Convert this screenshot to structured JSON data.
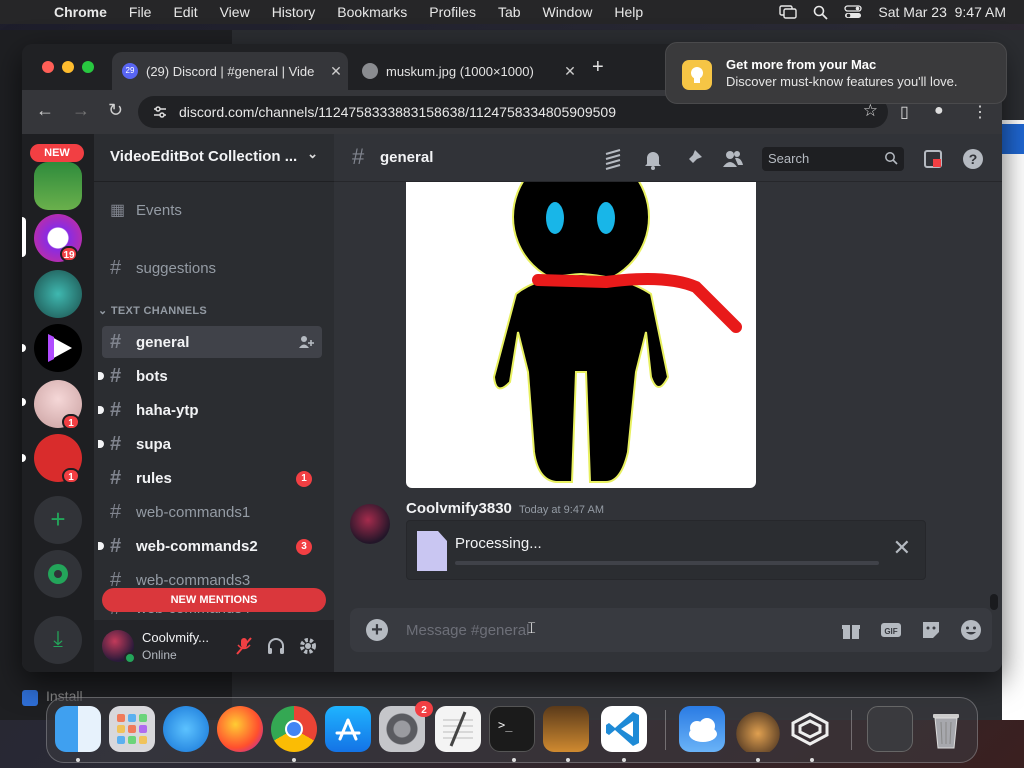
{
  "menubar": {
    "app": "Chrome",
    "items": [
      "File",
      "Edit",
      "View",
      "History",
      "Bookmarks",
      "Profiles",
      "Tab",
      "Window",
      "Help"
    ],
    "datetime": "Sat Mar 23  9:47 AM"
  },
  "browser": {
    "tabs": [
      {
        "title": "(29) Discord | #general | Vide",
        "badge": "29",
        "active": true
      },
      {
        "title": "muskum.jpg (1000×1000)",
        "active": false
      }
    ],
    "url": "discord.com/channels/1124758333883158638/1124758334805909509"
  },
  "notification": {
    "title": "Get more from your Mac",
    "body": "Discover must-know features you'll love."
  },
  "discord": {
    "guilds": [
      {
        "name": "new-server",
        "badge": null,
        "new_label": "NEW"
      },
      {
        "name": "video-server",
        "badge": "19"
      },
      {
        "name": "pool-server",
        "badge": null
      },
      {
        "name": "play-server",
        "badge": null
      },
      {
        "name": "anime-server",
        "badge": "1"
      },
      {
        "name": "red-server",
        "badge": "1"
      }
    ],
    "server": {
      "name": "VideoEditBot Collection ..."
    },
    "events_label": "Events",
    "suggestions_label": "suggestions",
    "category": "TEXT CHANNELS",
    "channels": [
      {
        "name": "general",
        "state": "active"
      },
      {
        "name": "bots",
        "state": "unread"
      },
      {
        "name": "haha-ytp",
        "state": "unread"
      },
      {
        "name": "supa",
        "state": "unread"
      },
      {
        "name": "rules",
        "state": "unread",
        "badge": "1"
      },
      {
        "name": "web-commands1",
        "state": "read"
      },
      {
        "name": "web-commands2",
        "state": "unread",
        "badge": "3"
      },
      {
        "name": "web-commands3",
        "state": "read"
      },
      {
        "name": "web-commands4",
        "state": "read"
      }
    ],
    "new_mentions": "NEW MENTIONS",
    "user": {
      "name": "Coolvmify...",
      "status": "Online"
    },
    "channel_header": "general",
    "search_placeholder": "Search",
    "message": {
      "author": "Coolvmify3830",
      "timestamp": "Today at 9:47 AM",
      "upload_status": "Processing..."
    },
    "composer_placeholder": "Message #general"
  },
  "background": {
    "install_label": "Install"
  },
  "dock": {
    "apps": [
      "finder-icon",
      "launchpad-icon",
      "safari-icon",
      "firefox-icon",
      "chrome-icon",
      "app-store-icon",
      "system-settings-icon",
      "textedit-icon",
      "terminal-icon",
      "garageband-icon",
      "vscode-icon",
      "weather-icon",
      "preview-icon",
      "virtualbox-icon",
      "screenshot-folder-icon",
      "trash-icon"
    ],
    "settings_badge": "2"
  }
}
